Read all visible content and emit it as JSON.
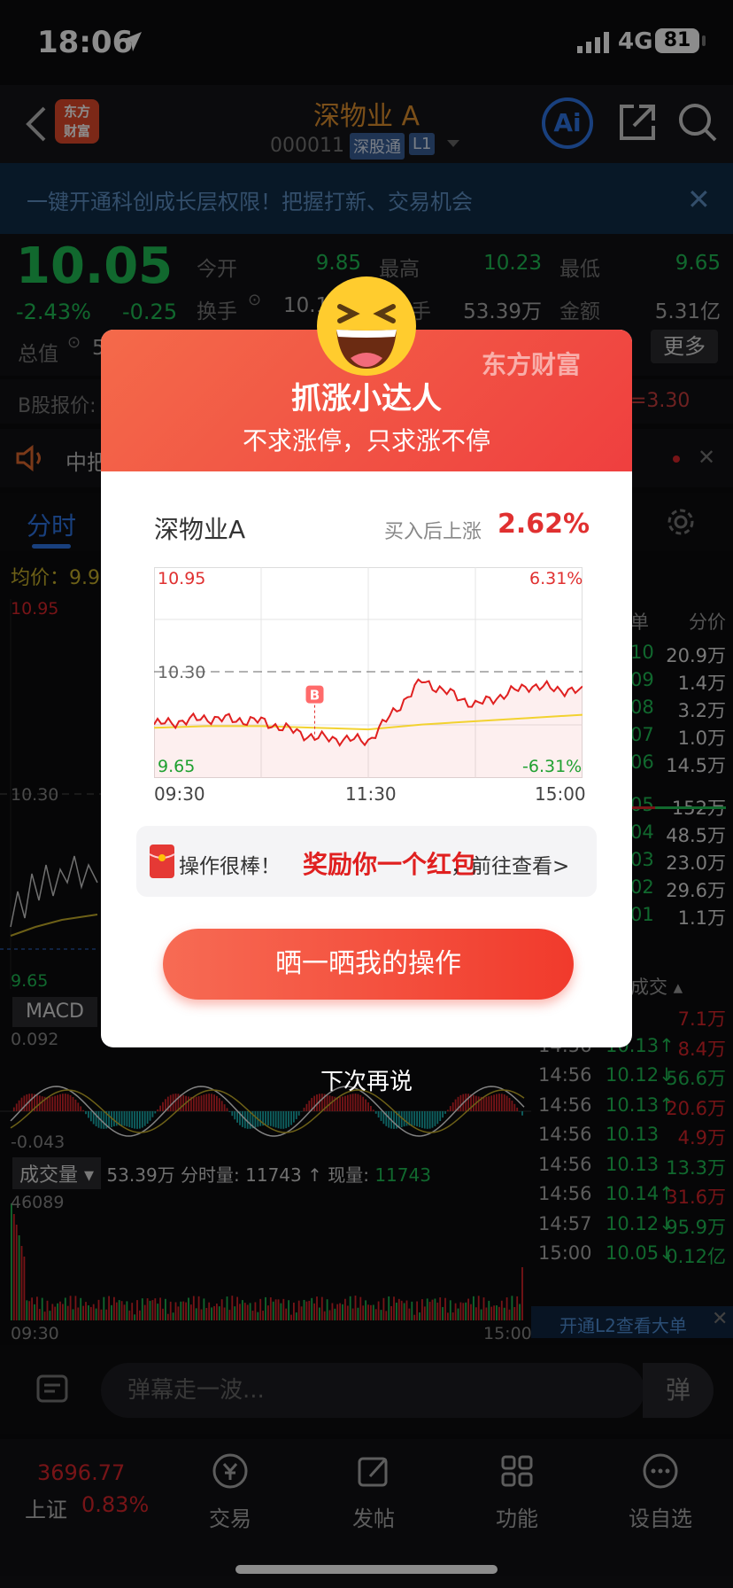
{
  "status": {
    "time": "18:06",
    "network": "4G",
    "battery": "81"
  },
  "nav": {
    "title": "深物业 A",
    "code": "000011",
    "tag1": "深股通",
    "tag2": "L1",
    "logo": "东方\n财富",
    "ai": "Ai"
  },
  "banner": {
    "text": "一键开通科创成长层权限！把握打新、交易机会"
  },
  "quote": {
    "price": "10.05",
    "pct": "-2.43%",
    "change": "-0.25",
    "open_label": "今开",
    "open": "9.85",
    "high_label": "最高",
    "high": "10.23",
    "low_label": "最低",
    "low": "9.65",
    "turnover_label": "换手",
    "turnover": "10.1",
    "volume_tail_label": "手",
    "volume": "53.39万",
    "amount_label": "金额",
    "amount": "5.31亿",
    "total_label": "总值",
    "total": "5",
    "more": "更多"
  },
  "bline": {
    "left": "B股报价:",
    "right": "=3.30"
  },
  "news": {
    "text": "中把"
  },
  "tabs": {
    "active": "分时"
  },
  "avg": "均价：9.9",
  "intraday": {
    "top": "10.95",
    "mid": "10.30",
    "bottom": "9.65"
  },
  "side": {
    "header_label": "单",
    "header_value": "分价",
    "rows": [
      {
        "p": "10",
        "v": "20.9万"
      },
      {
        "p": "09",
        "v": "1.4万"
      },
      {
        "p": "08",
        "v": "3.2万"
      },
      {
        "p": "07",
        "v": "1.0万"
      },
      {
        "p": "06",
        "v": "14.5万"
      },
      {
        "p": "05",
        "v": "152万"
      },
      {
        "p": "04",
        "v": "48.5万"
      },
      {
        "p": "03",
        "v": "23.0万"
      },
      {
        "p": "02",
        "v": "29.6万"
      },
      {
        "p": "01",
        "v": "1.1万"
      }
    ],
    "deal_label": "成交",
    "trades": [
      {
        "t": "",
        "p": "12",
        "v": "7.1万",
        "up": true
      },
      {
        "t": "14:56",
        "p": "10.13↑",
        "v": "8.4万",
        "up": true
      },
      {
        "t": "14:56",
        "p": "10.12↓",
        "v": "56.6万",
        "up": false
      },
      {
        "t": "14:56",
        "p": "10.13↑",
        "v": "20.6万",
        "up": true
      },
      {
        "t": "14:56",
        "p": "10.13",
        "v": "4.9万",
        "up": true
      },
      {
        "t": "14:56",
        "p": "10.13",
        "v": "13.3万",
        "up": false
      },
      {
        "t": "14:56",
        "p": "10.14↑",
        "v": "31.6万",
        "up": true
      },
      {
        "t": "14:57",
        "p": "10.12↓",
        "v": "95.9万",
        "up": false
      },
      {
        "t": "15:00",
        "p": "10.05↓",
        "v": "0.12亿",
        "up": false
      }
    ],
    "l2": "开通L2查看大单"
  },
  "macd": {
    "label": "MACD",
    "top": "0.092",
    "bottom": "-0.043"
  },
  "volume": {
    "label": "成交量",
    "summary": "53.39万 分时量: 11743 ↑ 现量:",
    "now": "11743",
    "max": "46089",
    "start": "09:30",
    "end": "15:00"
  },
  "danmu": {
    "placeholder": "弹幕走一波...",
    "btn": "弹"
  },
  "tabbar": {
    "index_value": "3696.77",
    "index_name": "上证",
    "index_pct": "0.83%",
    "items": [
      {
        "label": "交易"
      },
      {
        "label": "发帖"
      },
      {
        "label": "功能"
      },
      {
        "label": "设自选"
      }
    ]
  },
  "modal": {
    "brand": "东方财富",
    "title": "抓涨小达人",
    "subtitle": "不求涨停，只求涨不停",
    "stock": "深物业A",
    "rise_label": "买入后上涨",
    "rise_value": "2.62%",
    "chart": {
      "top_left": "10.95",
      "top_right": "6.31%",
      "mid_left": "10.30",
      "bottom_left": "9.65",
      "bottom_right": "-6.31%",
      "marker": "B",
      "t0": "09:30",
      "t1": "11:30",
      "t2": "15:00"
    },
    "reward_1": "操作很棒！",
    "reward_2": "奖励你一个红包",
    "reward_3": "，前往查看>",
    "share": "晒一晒我的操作",
    "later": "下次再说"
  },
  "chart_data": {
    "type": "line",
    "x": [
      "09:30",
      "10:00",
      "10:30",
      "11:00",
      "11:30",
      "13:30",
      "14:00",
      "14:30",
      "15:00"
    ],
    "series": [
      {
        "values": [
          9.98,
          10.02,
          10.0,
          9.9,
          9.88,
          10.25,
          10.1,
          10.22,
          10.18
        ]
      },
      {
        "values": [
          9.96,
          9.97,
          9.97,
          9.96,
          9.95,
          9.98,
          10.0,
          10.02,
          10.04
        ]
      }
    ],
    "ylim": [
      9.65,
      10.95
    ],
    "ylabel_right": [
      "6.31%",
      "-6.31%"
    ],
    "reference": 10.3,
    "buy_marker_x": "11:00"
  },
  "colors": {
    "up": "#e03030",
    "down": "#1fbd55",
    "accent": "#2f76e6",
    "modal": "#ef4a3a"
  }
}
